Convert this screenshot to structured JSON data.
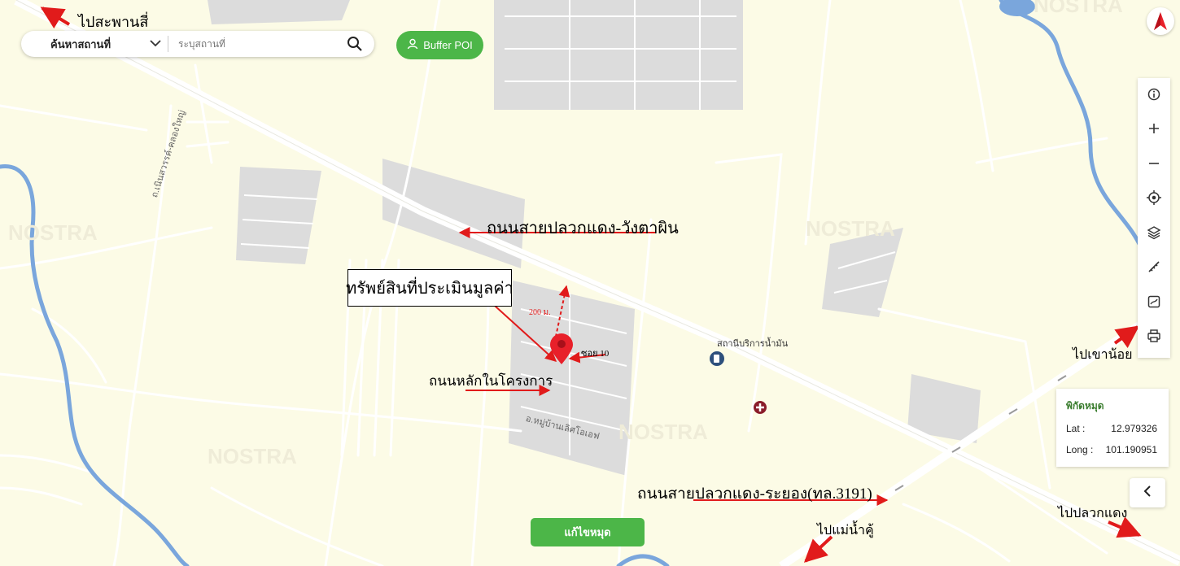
{
  "search": {
    "type_label": "ค้นหาสถานที่",
    "placeholder": "ระบุสถานที่"
  },
  "buffer_button": {
    "label": "Buffer POI"
  },
  "edit_pin_button": {
    "label": "แก้ไขหมุด"
  },
  "coordinates": {
    "title": "พิกัดหมุด",
    "lat_label": "Lat :",
    "lat_value": "12.979326",
    "long_label": "Long :",
    "long_value": "101.190951"
  },
  "annotations": {
    "to_saphan_si": "ไปสะพานสี่",
    "road_main_north": "ถนนสายปลวกแดง-วังตาผิน",
    "property": "ทรัพย์สินที่ประเมินมูลค่า",
    "project_main_road": "ถนนหลักในโครงการ",
    "road_rayong": "ถนนสายปลวกแดง-ระยอง(ทล.3191)",
    "to_khao_noi": "ไปเขาน้อย",
    "to_mae_nam_khu": "ไปแม่น้ำคู้",
    "to_pluak_daeng": "ไปปลวกแดง",
    "distance": "200 ม.",
    "soi": "ซอย 10"
  },
  "map_labels": {
    "gas_station": "สถานีบริการน้ำมัน",
    "village": "อ.หมู่บ้านเลิศโอเอฟ",
    "road_side": "ถ.เนินสวรรค์-คลองใหญ่"
  },
  "watermark": "NOSTRA",
  "icons": [
    "search-icon",
    "chevron-down-icon",
    "user-icon",
    "north-arrow-icon",
    "info-icon",
    "zoom-in-icon",
    "zoom-out-icon",
    "locate-icon",
    "layers-icon",
    "ruler-icon",
    "draw-icon",
    "print-icon",
    "chevron-left-icon",
    "location-pin-icon",
    "gas-station-icon",
    "hospital-icon"
  ],
  "colors": {
    "accent_green": "#4cb648",
    "pin_red": "#e8202a",
    "arrow_red": "#e11b1b",
    "river_blue": "#7aa6dc"
  }
}
